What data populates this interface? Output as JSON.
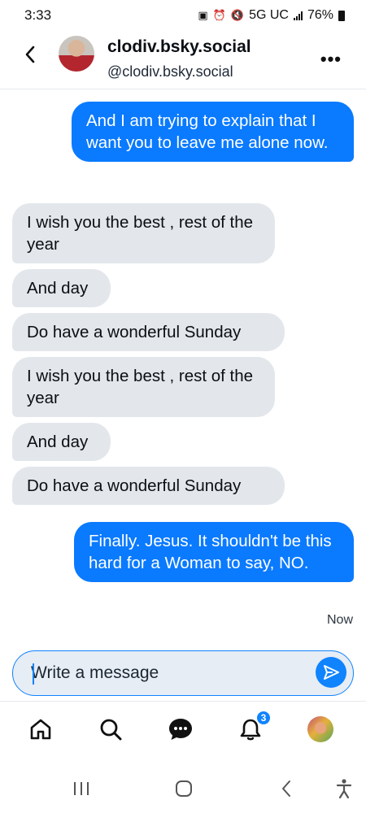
{
  "status_bar": {
    "time": "3:33",
    "network": "5G UC",
    "battery": "76%"
  },
  "header": {
    "display_name": "clodiv.bsky.social",
    "handle": "@clodiv.bsky.social"
  },
  "messages": [
    {
      "direction": "sent",
      "text": "And I am trying to explain that I want you to leave me alone now."
    },
    {
      "direction": "received",
      "text": "I wish you the best , rest of the year"
    },
    {
      "direction": "received",
      "text": "And day"
    },
    {
      "direction": "received",
      "text": "Do have a wonderful Sunday"
    },
    {
      "direction": "received",
      "text": "I wish you the best , rest of the year"
    },
    {
      "direction": "received",
      "text": "And day"
    },
    {
      "direction": "received",
      "text": "Do have a wonderful Sunday"
    },
    {
      "direction": "sent",
      "text": "Finally. Jesus. It shouldn't be this hard for a Woman to say, NO."
    }
  ],
  "last_message_time": "Now",
  "composer": {
    "placeholder": "Write a message"
  },
  "tabbar": {
    "notifications_count": "3"
  },
  "colors": {
    "accent": "#0a7aff",
    "received_bubble": "#e3e7eb"
  },
  "icons": [
    "back-icon",
    "more-icon",
    "send-icon",
    "home-icon",
    "search-icon",
    "chat-icon",
    "bell-icon",
    "recents-icon",
    "home-pill-icon",
    "nav-back-icon",
    "accessibility-icon"
  ]
}
